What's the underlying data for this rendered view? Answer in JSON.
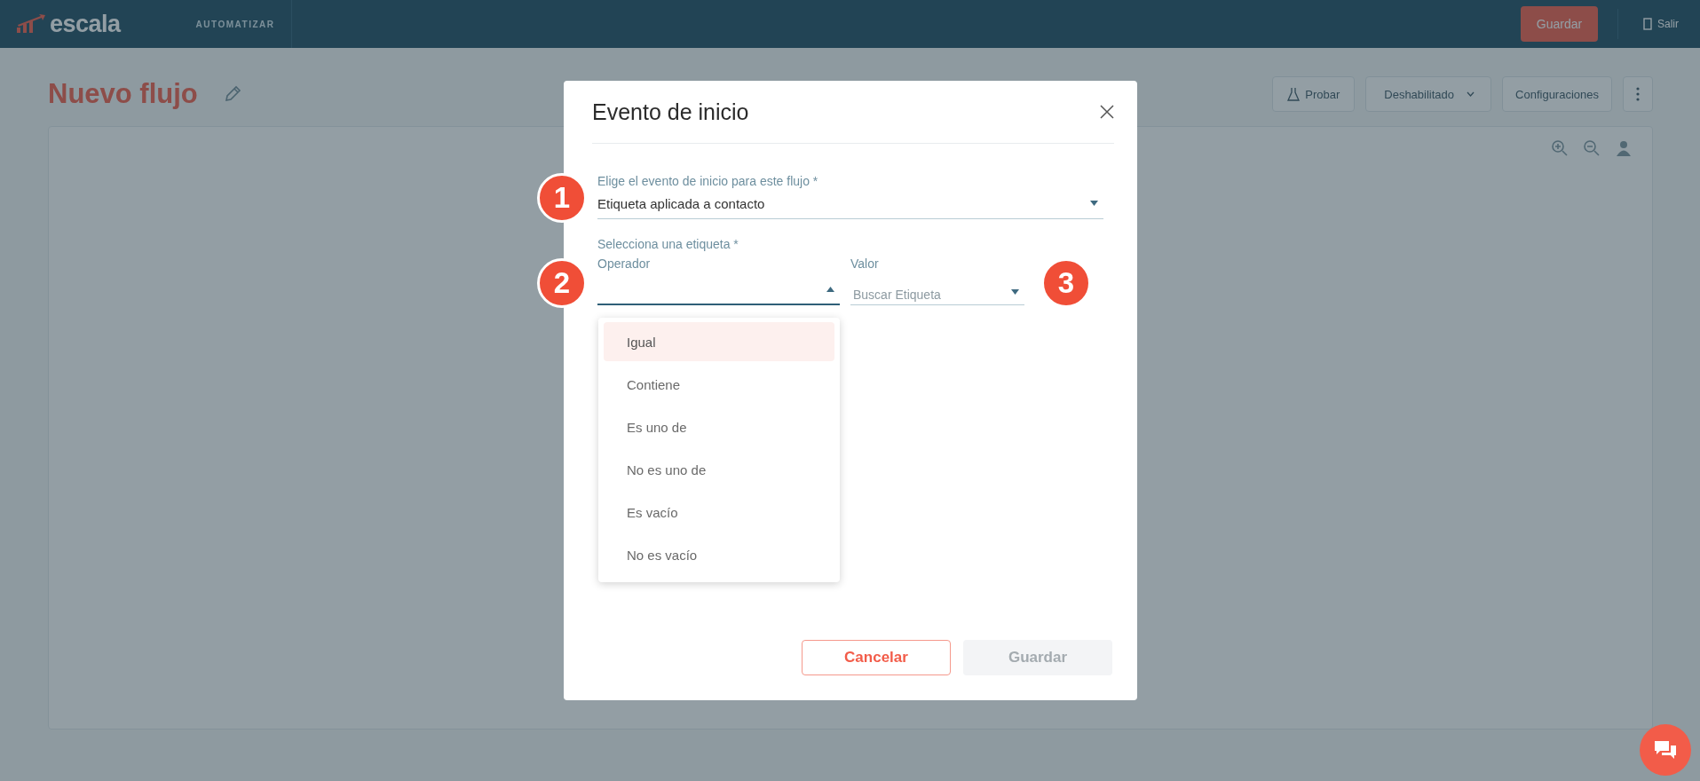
{
  "header": {
    "logo_text": "escala",
    "section": "AUTOMATIZAR",
    "save_button": "Guardar",
    "logout": "Salir"
  },
  "page": {
    "title": "Nuevo flujo",
    "actions": [
      {
        "kind": "test",
        "label": "Probar"
      },
      {
        "kind": "dropdown",
        "label": "Deshabilitado"
      },
      {
        "kind": "plain",
        "label": "Configuraciones"
      },
      {
        "kind": "more"
      }
    ]
  },
  "modal": {
    "title": "Evento de inicio",
    "event_field": {
      "label": "Elige el evento de inicio para este flujo *",
      "value": "Etiqueta aplicada a contacto"
    },
    "tag_section_label": "Selecciona una etiqueta *",
    "operator_field": {
      "label": "Operador",
      "expanded": true
    },
    "value_field": {
      "label": "Valor",
      "placeholder": "Buscar Etiqueta",
      "expanded": false
    },
    "operator_options": [
      {
        "label": "Igual",
        "selected": true
      },
      {
        "label": "Contiene",
        "selected": false
      },
      {
        "label": "Es uno de",
        "selected": false
      },
      {
        "label": "No es uno de",
        "selected": false
      },
      {
        "label": "Es vacío",
        "selected": false
      },
      {
        "label": "No es vacío",
        "selected": false
      }
    ],
    "buttons": [
      {
        "kind": "outline",
        "label": "Cancelar",
        "disabled": false
      },
      {
        "kind": "primary",
        "label": "Guardar",
        "disabled": true
      }
    ]
  },
  "callouts": [
    {
      "number": "1"
    },
    {
      "number": "2"
    },
    {
      "number": "3"
    }
  ]
}
